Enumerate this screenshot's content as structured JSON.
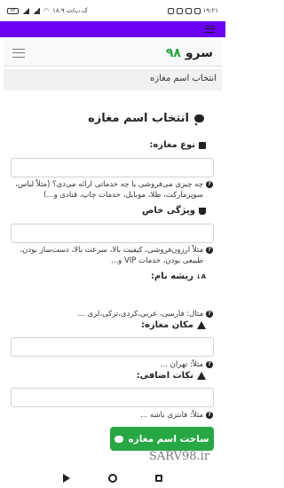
{
  "status_bar": {
    "battery": "۸۲",
    "time": "۱۹:۲۱",
    "network": "۱۸.۹ ک.ب/ث"
  },
  "navbar": {
    "brand_text": "سرو",
    "brand_number": "۹۸"
  },
  "breadcrumb": "انتخاب اسم مغازه",
  "form": {
    "title": "انتخاب اسم مغازه",
    "fields": [
      {
        "label": "نوع مغازه:",
        "icon": "store-icon",
        "help": "چه چیزی می‌فروشی یا چه خدماتی ارائه می‌دی؟ (مثلاً لباس، سوپرمارکت، طلا، موبایل، خدمات چاپ، قنادی و...)"
      },
      {
        "label": "ویژگی خاص",
        "icon": "basket-icon",
        "help": "مثلاً ارزون‌فروشی، کیفیت بالا، سرعت بالا، دست‌ساز بودن، طبیعی بودن، خدمات VIP و..."
      },
      {
        "label": "ریشه نام:",
        "icon": "sort-az-icon",
        "help": "مثال: فارسی، عربی،کردی،ترکی،لری ..."
      },
      {
        "label": "مکان مغازه:",
        "icon": "warning-icon",
        "help": "مثلاً: تهران ..."
      },
      {
        "label": "نکات اضافی:",
        "icon": "warning-icon",
        "help": "مثلاً: فانتزی باشه ..."
      }
    ],
    "submit_label": "ساخت اسم مغازه"
  },
  "watermark": "SARV98.ir",
  "colors": {
    "app_bar": "#6a00f4",
    "accent": "#28a745"
  }
}
